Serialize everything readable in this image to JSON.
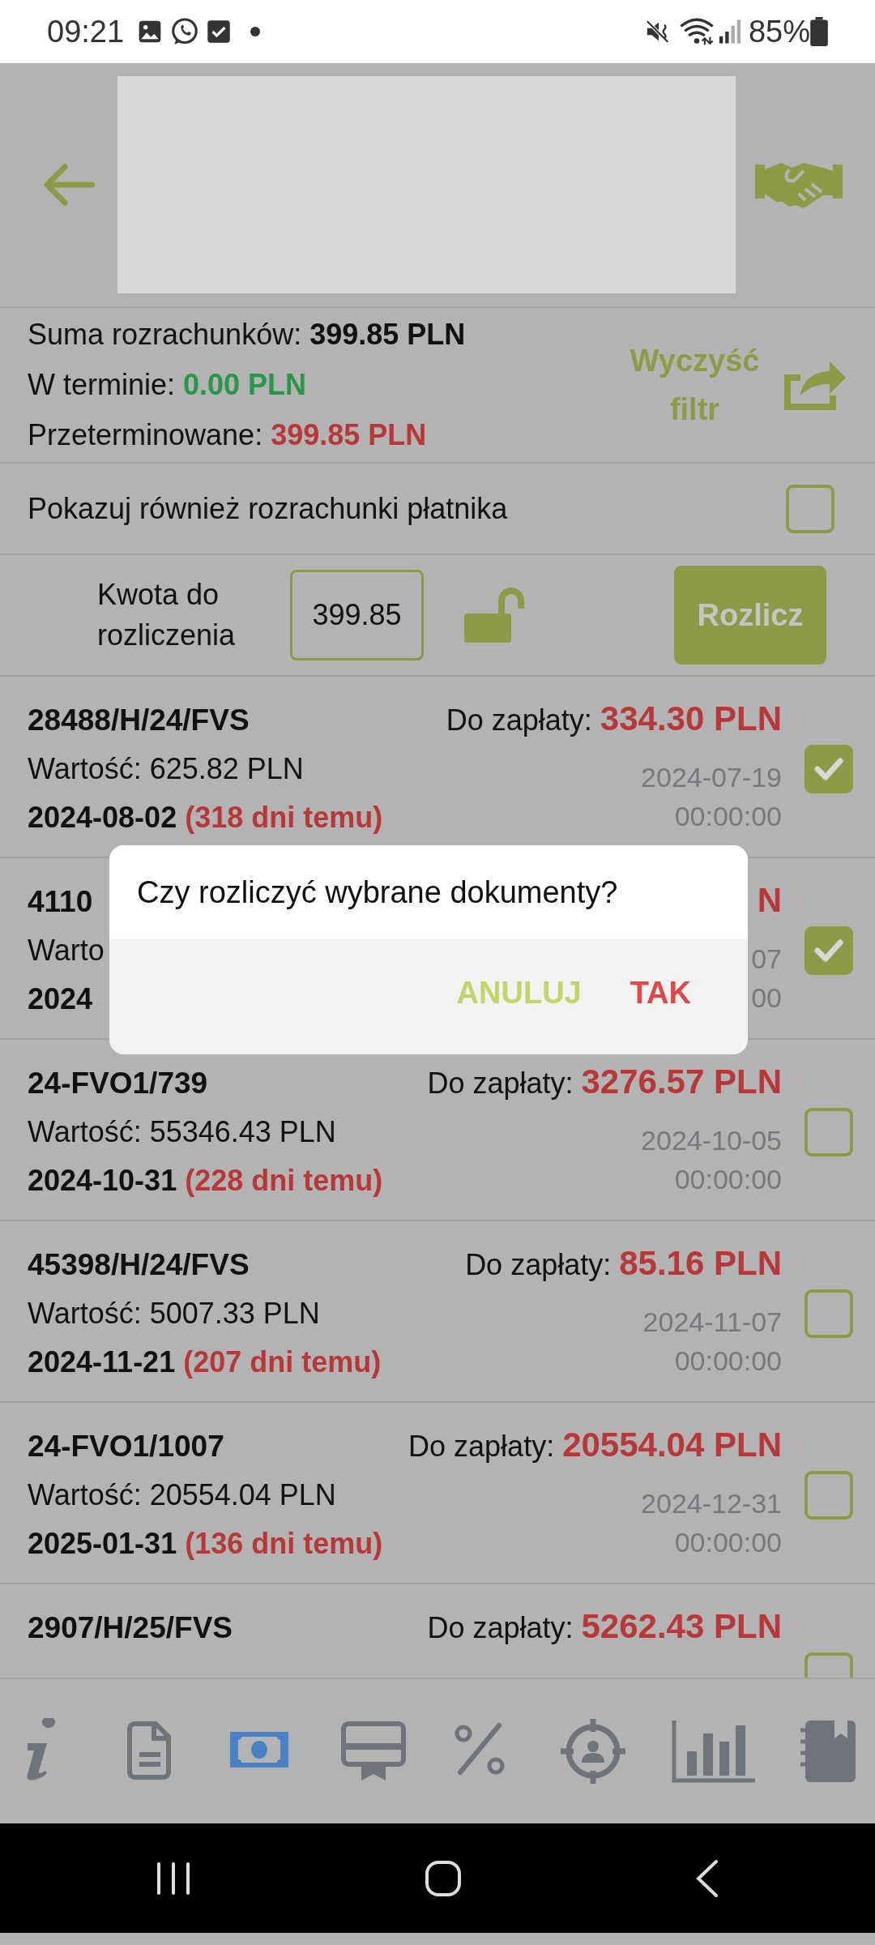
{
  "status_bar": {
    "time": "09:21",
    "battery": "85%"
  },
  "summary": {
    "total_label": "Suma rozrachunków:",
    "total": "399.85 PLN",
    "on_time_label": "W terminie:",
    "on_time": "0.00 PLN",
    "overdue_label": "Przeterminowane:",
    "overdue": "399.85 PLN",
    "clear_filter": "Wyczyść filtr"
  },
  "payer_toggle": {
    "label": "Pokazuj również rozrachunki płatnika",
    "checked": false
  },
  "settle": {
    "label": "Kwota do rozliczenia",
    "value": "399.85",
    "locked": false,
    "button": "Rozlicz"
  },
  "documents": [
    {
      "number": "28488/H/24/FVS",
      "due_label": "Do zapłaty:",
      "due": "334.30 PLN",
      "value": "Wartość: 625.82 PLN",
      "date": "2024-08-02",
      "overdue": "(318 dni temu)",
      "created_date": "2024-07-19",
      "created_time": "00:00:00",
      "checked": true
    },
    {
      "number": "4110",
      "due": "N",
      "value": "Warto",
      "date": "2024",
      "created_date": "07",
      "created_time": "00",
      "checked": true
    },
    {
      "number": "24-FVO1/739",
      "due_label": "Do zapłaty:",
      "due": "3276.57 PLN",
      "value": "Wartość: 55346.43 PLN",
      "date": "2024-10-31",
      "overdue": "(228 dni temu)",
      "created_date": "2024-10-05",
      "created_time": "00:00:00",
      "checked": false
    },
    {
      "number": "45398/H/24/FVS",
      "due_label": "Do zapłaty:",
      "due": "85.16 PLN",
      "value": "Wartość: 5007.33 PLN",
      "date": "2024-11-21",
      "overdue": "(207 dni temu)",
      "created_date": "2024-11-07",
      "created_time": "00:00:00",
      "checked": false
    },
    {
      "number": "24-FVO1/1007",
      "due_label": "Do zapłaty:",
      "due": "20554.04 PLN",
      "value": "Wartość: 20554.04 PLN",
      "date": "2025-01-31",
      "overdue": "(136 dni temu)",
      "created_date": "2024-12-31",
      "created_time": "00:00:00",
      "checked": false
    },
    {
      "number": "2907/H/25/FVS",
      "due_label": "Do zapłaty:",
      "due": "5262.43 PLN",
      "checked": false
    }
  ],
  "dialog": {
    "message": "Czy rozliczyć wybrane dokumenty?",
    "buttons": [
      {
        "label": "ANULUJ",
        "kind": "cancel"
      },
      {
        "label": "TAK",
        "kind": "confirm"
      }
    ]
  },
  "bottom_nav": [
    {
      "selected": false
    },
    {
      "selected": false
    },
    {
      "selected": true
    },
    {
      "selected": false
    },
    {
      "selected": false
    },
    {
      "selected": false
    },
    {
      "selected": false
    },
    {
      "selected": false
    }
  ]
}
